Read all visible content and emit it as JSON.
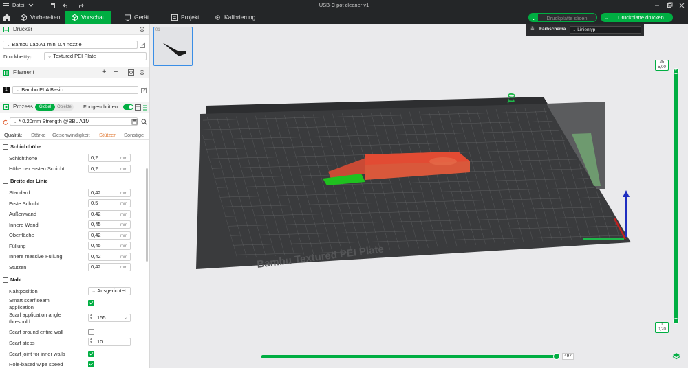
{
  "titlebar": {
    "file_menu": "Datei",
    "window_title": "USB-C pot cleaner v1"
  },
  "toolbar": {
    "tabs": [
      {
        "label": "Vorbereiten",
        "icon": "cube-icon"
      },
      {
        "label": "Vorschau",
        "icon": "cube-icon",
        "active": true
      },
      {
        "label": "Gerät",
        "icon": "device-icon"
      },
      {
        "label": "Projekt",
        "icon": "project-icon"
      },
      {
        "label": "Kalibrierung",
        "icon": "calibration-icon"
      }
    ],
    "slice_label": "Druckplatte slicen",
    "print_label": "Druckplatte drucken",
    "accent": "#00ae42"
  },
  "sidebar": {
    "printer": {
      "header": "Drucker",
      "printer_name": "Bambu Lab A1 mini 0.4 nozzle",
      "bed_type_label": "Druckbetttyp",
      "bed_type_value": "Textured PEI Plate"
    },
    "filament": {
      "header": "Filament",
      "index": "1",
      "name": "Bambu PLA Basic"
    },
    "process": {
      "header": "Prozess",
      "toggle_global": "Global",
      "toggle_objects": "Objekte",
      "advanced_label": "Fortgeschritten",
      "preset": "* 0.20mm Strength @BBL A1M"
    },
    "tabs": [
      "Qualität",
      "Stärke",
      "Geschwindigkeit",
      "Stützen",
      "Sonstige"
    ],
    "groups": {
      "layer_height": {
        "title": "Schichthöhe",
        "rows": [
          {
            "label": "Schichthöhe",
            "value": "0,2",
            "unit": "mm"
          },
          {
            "label": "Höhe der ersten Schicht",
            "value": "0,2",
            "unit": "mm"
          }
        ]
      },
      "line_width": {
        "title": "Breite der Linie",
        "rows": [
          {
            "label": "Standard",
            "value": "0,42",
            "unit": "mm"
          },
          {
            "label": "Erste Schicht",
            "value": "0,5",
            "unit": "mm"
          },
          {
            "label": "Außenwand",
            "value": "0,42",
            "unit": "mm"
          },
          {
            "label": "Innere Wand",
            "value": "0,45",
            "unit": "mm"
          },
          {
            "label": "Oberfläche",
            "value": "0,42",
            "unit": "mm"
          },
          {
            "label": "Füllung",
            "value": "0,45",
            "unit": "mm"
          },
          {
            "label": "Innere massive Füllung",
            "value": "0,42",
            "unit": "mm"
          },
          {
            "label": "Stützen",
            "value": "0,42",
            "unit": "mm"
          }
        ]
      },
      "seam": {
        "title": "Naht",
        "position_label": "Nahtposition",
        "position_value": "Ausgerichtet",
        "smart_scarf_label_1": "Smart scarf seam",
        "smart_scarf_label_2": "application",
        "angle_label_1": "Scarf application angle",
        "angle_label_2": "threshold",
        "angle_value": "155",
        "around_wall_label": "Scarf around entire wall",
        "steps_label": "Scarf steps",
        "steps_value": "10",
        "inner_walls_label": "Scarf joint for inner walls",
        "wipe_speed_label": "Role-based wipe speed"
      }
    }
  },
  "viewport": {
    "legend_title": "Farbschema",
    "legend_value": "Linientyp",
    "plate_text": "Bambu Textured PEI Plate",
    "plate_number": "01",
    "layer_top_num": "25",
    "layer_top_height": "5,00",
    "layer_bottom_num": "1",
    "layer_bottom_height": "0,20",
    "horizontal_slider_value": "497",
    "colors": {
      "wall": "#d9583b",
      "top_surface": "#e0442f",
      "support": "#1fc11f",
      "bed": "#3a3b3d"
    }
  }
}
